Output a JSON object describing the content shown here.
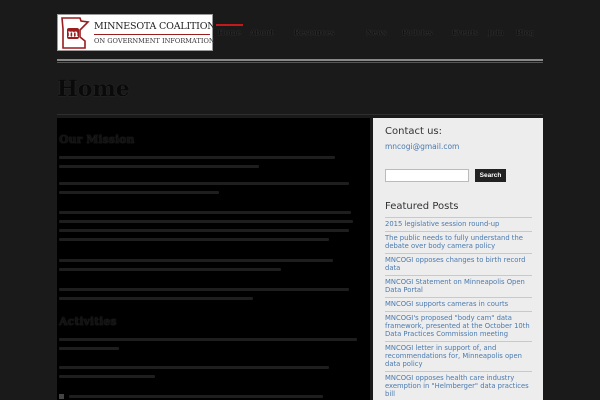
{
  "header": {
    "logo_line1": "MINNESOTA COALITION",
    "logo_line2": "ON GOVERNMENT INFORMATION",
    "logo_mark_letter": "m",
    "logo_mark_color": "#9a1c1c",
    "nav_accent_color": "#c21a1a",
    "nav": [
      "Home",
      "About",
      "Resources",
      "News",
      "Policies",
      "Events",
      "Join",
      "Blog"
    ]
  },
  "page": {
    "title": "Home"
  },
  "main": {
    "headings": [
      "Our Mission",
      "Activities"
    ]
  },
  "sidebar": {
    "contact_heading": "Contact us:",
    "contact_email": "mncogi@gmail.com",
    "search_placeholder": "",
    "search_button": "Search",
    "featured_heading": "Featured Posts",
    "link_color": "#4a7ab0",
    "featured_posts": [
      "2015 legislative session round-up",
      "The public needs to fully understand the debate over body camera policy",
      "MNCOGI opposes changes to birth record data",
      "MNCOGI Statement on Minneapolis Open Data Portal",
      "MNCOGI supports cameras in courts",
      "MNCOGI's proposed \"body cam\" data framework, presented at the October 10th Data Practices Commission meeting",
      "MNCOGI letter in support of, and recommendations for, Minneapolis open data policy",
      "MNCOGI opposes health care industry exemption in \"Helmberger\" data practices bill"
    ]
  }
}
